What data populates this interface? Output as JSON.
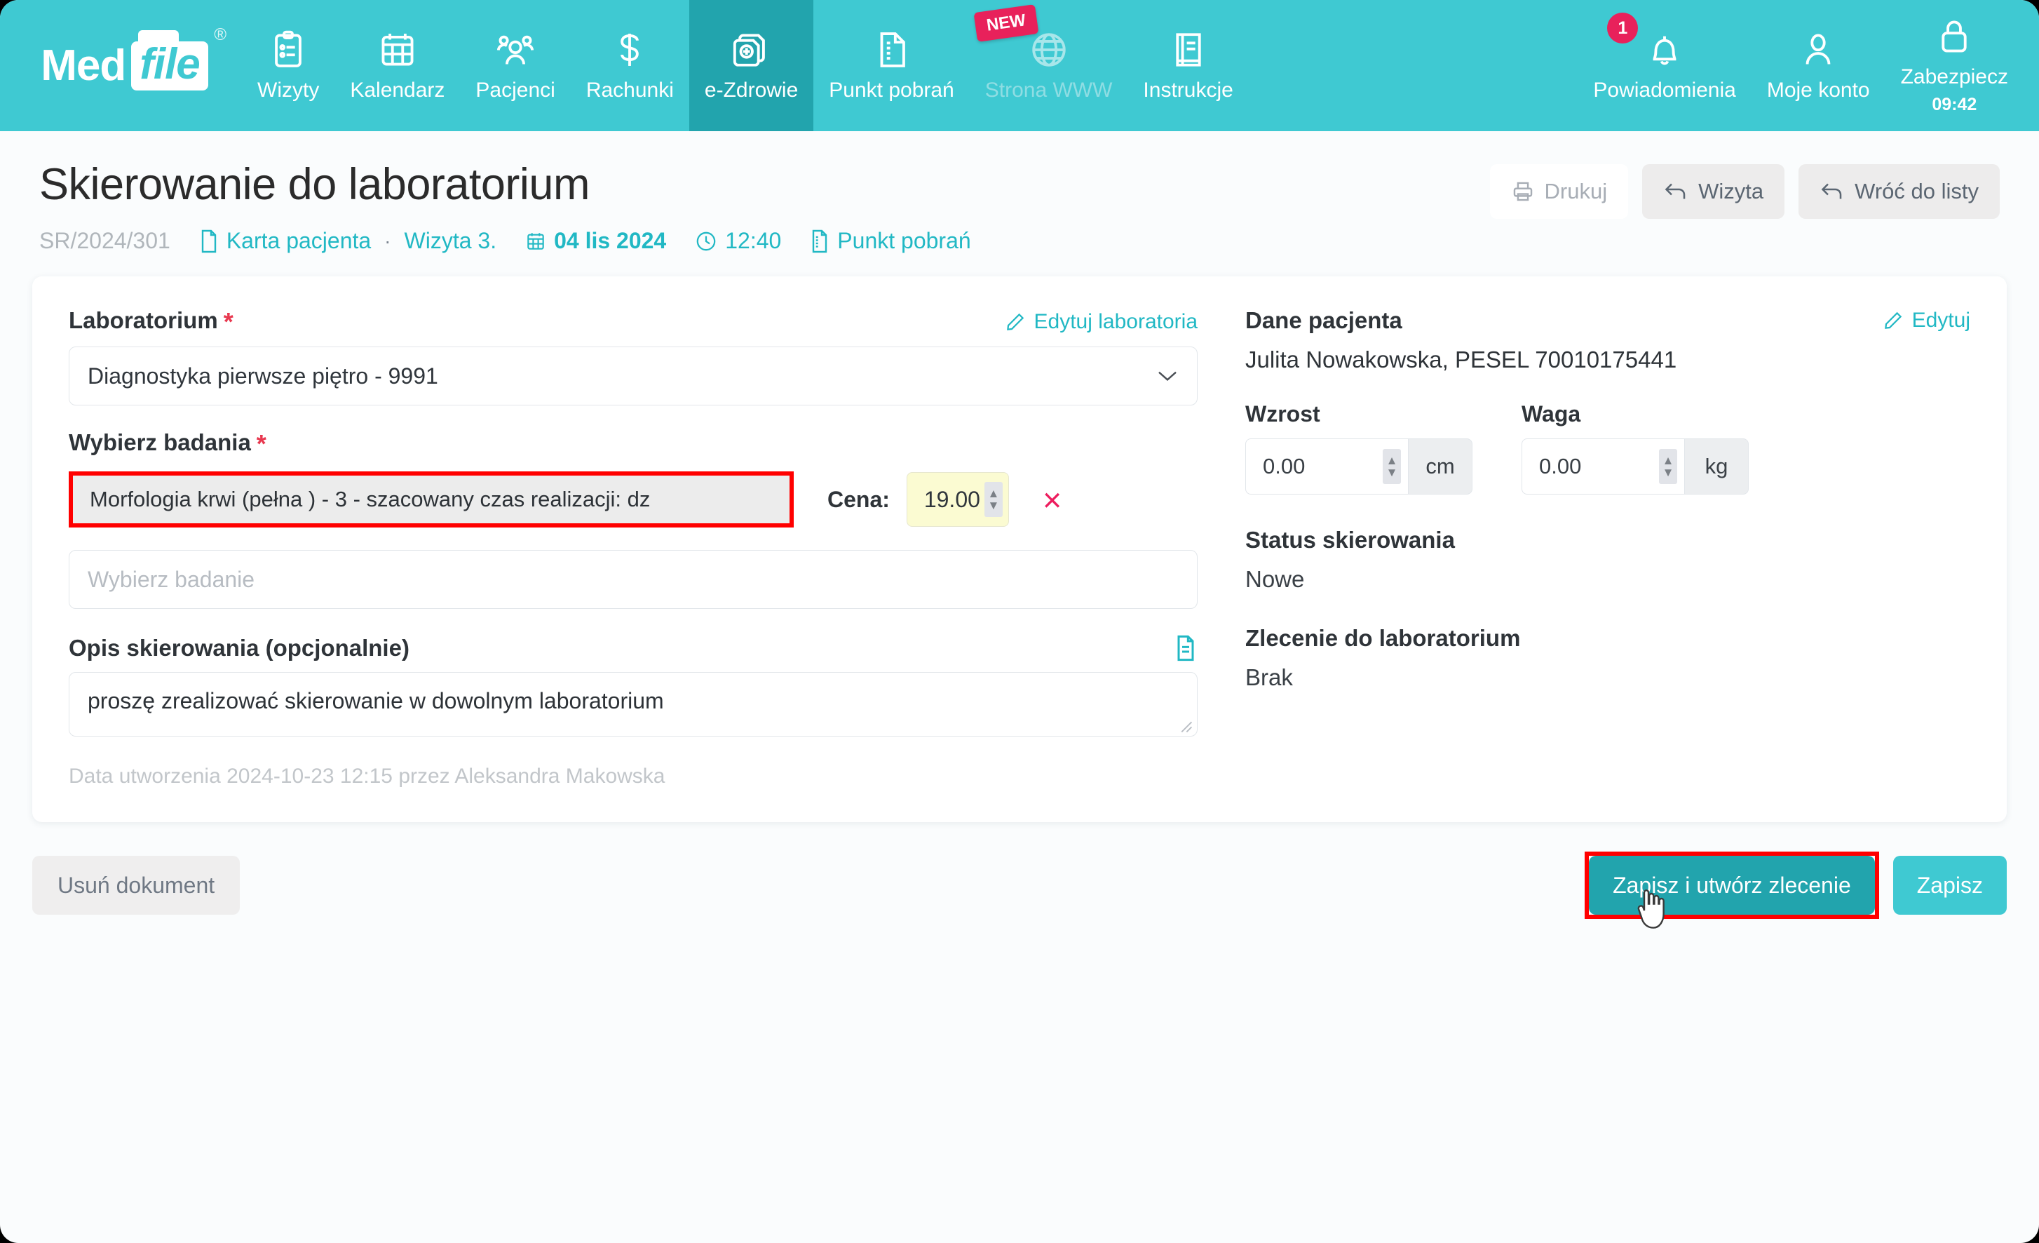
{
  "brand": {
    "med": "Med",
    "file": "file",
    "reg": "®"
  },
  "nav": {
    "items": [
      {
        "label": "Wizyty",
        "icon": "clipboard-icon",
        "state": "normal"
      },
      {
        "label": "Kalendarz",
        "icon": "calendar-icon",
        "state": "normal"
      },
      {
        "label": "Pacjenci",
        "icon": "users-icon",
        "state": "normal"
      },
      {
        "label": "Rachunki",
        "icon": "dollar-icon",
        "state": "normal"
      },
      {
        "label": "e-Zdrowie",
        "icon": "ehealth-icon",
        "state": "active"
      },
      {
        "label": "Punkt pobrań",
        "icon": "document-lines-icon",
        "state": "normal"
      },
      {
        "label": "Strona WWW",
        "icon": "globe-icon",
        "state": "muted",
        "badge": "NEW"
      },
      {
        "label": "Instrukcje",
        "icon": "book-icon",
        "state": "normal"
      }
    ],
    "right": [
      {
        "label": "Powiadomienia",
        "icon": "bell-icon",
        "badge": "1"
      },
      {
        "label": "Moje konto",
        "icon": "user-icon"
      },
      {
        "label": "Zabezpiecz",
        "icon": "lock-icon",
        "clock": "09:42"
      }
    ]
  },
  "header": {
    "title": "Skierowanie do laboratorium",
    "actions": [
      {
        "label": "Drukuj",
        "icon": "printer-icon",
        "style": "ghost"
      },
      {
        "label": "Wizyta",
        "icon": "back-arrow-icon",
        "style": "grey"
      },
      {
        "label": "Wróć do listy",
        "icon": "back-arrow-icon",
        "style": "grey"
      }
    ]
  },
  "breadcrumb": {
    "doc_number": "SR/2024/301",
    "patient_card": "Karta pacjenta",
    "separator": "·",
    "visit": "Wizyta 3.",
    "date": "04 lis 2024",
    "time": "12:40",
    "collection_point": "Punkt pobrań"
  },
  "form": {
    "lab_label": "Laboratorium",
    "required_mark": "*",
    "edit_labs_link": "Edytuj laboratoria",
    "lab_value": "Diagnostyka pierwsze piętro - 9991",
    "exams_label": "Wybierz badania",
    "selected_exam": "Morfologia krwi (pełna )  - 3 - szacowany czas realizacji: dz",
    "price_label": "Cena:",
    "price_value": "19.00",
    "remove_icon": "×",
    "exam_placeholder": "Wybierz badanie",
    "description_label": "Opis skierowania (opcjonalnie)",
    "description_value": "proszę zrealizować skierowanie w dowolnym laboratorium",
    "created_text": "Data utworzenia 2024-10-23 12:15 przez  Aleksandra Makowska"
  },
  "patient": {
    "section_title": "Dane pacjenta",
    "edit_link": "Edytuj",
    "name_pesel": "Julita Nowakowska, PESEL 70010175441",
    "height_label": "Wzrost",
    "height_value": "0.00",
    "height_unit": "cm",
    "weight_label": "Waga",
    "weight_value": "0.00",
    "weight_unit": "kg",
    "status_title": "Status skierowania",
    "status_value": "Nowe",
    "order_title": "Zlecenie do laboratorium",
    "order_value": "Brak"
  },
  "footer": {
    "delete_label": "Usuń dokument",
    "save_create_label": "Zapisz i utwórz zlecenie",
    "save_label": "Zapisz"
  },
  "colors": {
    "brand_teal": "#3fc9d2",
    "active_teal": "#22a4ad",
    "link_teal": "#21b8c4",
    "badge_pink": "#e8215b",
    "highlight_red": "#ff0000",
    "price_yellow": "#fbfbd2"
  }
}
